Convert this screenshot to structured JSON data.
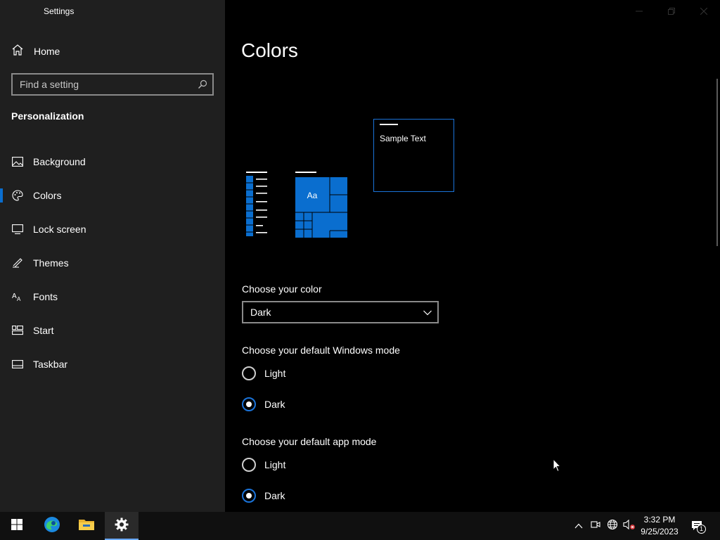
{
  "window": {
    "title": "Settings"
  },
  "sidebar": {
    "home_label": "Home",
    "search_placeholder": "Find a setting",
    "section_title": "Personalization",
    "items": [
      {
        "label": "Background",
        "icon": "picture-icon"
      },
      {
        "label": "Colors",
        "icon": "palette-icon",
        "active": true
      },
      {
        "label": "Lock screen",
        "icon": "lock-screen-icon"
      },
      {
        "label": "Themes",
        "icon": "brush-icon"
      },
      {
        "label": "Fonts",
        "icon": "fonts-icon"
      },
      {
        "label": "Start",
        "icon": "start-icon"
      },
      {
        "label": "Taskbar",
        "icon": "taskbar-icon"
      }
    ]
  },
  "main": {
    "title": "Colors",
    "preview": {
      "sample_text": "Sample Text",
      "tile_text": "Aa"
    },
    "choose_color": {
      "label": "Choose your color",
      "selected": "Dark"
    },
    "windows_mode": {
      "label": "Choose your default Windows mode",
      "options": [
        "Light",
        "Dark"
      ],
      "selected": "Dark"
    },
    "app_mode": {
      "label": "Choose your default app mode",
      "options": [
        "Light",
        "Dark"
      ],
      "selected": "Dark"
    }
  },
  "taskbar": {
    "time": "3:32 PM",
    "date": "9/25/2023",
    "notification_count": "1"
  },
  "colors": {
    "accent": "#0a6ecf",
    "sidebar_bg": "#1f1f1f",
    "main_bg": "#000000",
    "taskbar_bg": "#101010"
  }
}
